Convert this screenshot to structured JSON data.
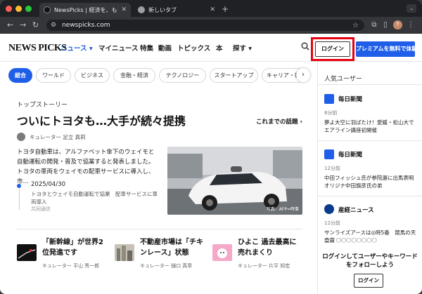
{
  "browser": {
    "tabs": [
      {
        "title": "NewsPicks | 経済を、もっとおも",
        "active": true
      },
      {
        "title": "新しいタブ",
        "active": false
      }
    ],
    "new_tab": "+",
    "url": "newspicks.com",
    "profile_initial": "T"
  },
  "header": {
    "logo": "NEWS PICKS",
    "nav": [
      "ニュース ▾",
      "マイニュース",
      "特集",
      "動画",
      "トピックス",
      "本",
      "探す ▾"
    ],
    "login": "ログイン",
    "premium": "プレミアムを無料で体験"
  },
  "chips": [
    "総合",
    "ワールド",
    "ビジネス",
    "金融・経済",
    "テクノロジー",
    "スタートアップ",
    "キャリア・教"
  ],
  "top_story": {
    "section": "トップストーリー",
    "headline": "ついにトヨタも…大手が続々提携",
    "more": "これまでの話題 ›",
    "curator": "キュレーター 足立 真莉",
    "body": "トヨタ自動車は、アルファベット傘下のウェイモと自動運転の開発・普及で協業すると発表しました。トヨタの車両をウェイモの配車サービスに導入し、市…",
    "timeline_date": "2025/04/30",
    "timeline_text": "トヨタとウェイモ自動運転で協業　配車サービスに車両導入",
    "timeline_source": "共同通信",
    "photo_credit": "写真：AFP=時事"
  },
  "cards": [
    {
      "title": "「新幹線」が世界2位発進です",
      "curator": "キュレーター 平山 秀一郎"
    },
    {
      "title": "不動産市場は「チキンレース」状態",
      "curator": "キュレーター 樋口 真章"
    },
    {
      "title": "ひよこ 過去最高に売れまくり",
      "curator": "キュレーター 片平 知宏"
    }
  ],
  "sidebar": {
    "title": "人気ユーザー",
    "items": [
      {
        "name": "毎日新聞",
        "time": "8分前",
        "text": "夢よ大空に羽ばたけ！愛媛・松山大でエアライン講座初開催",
        "icon_color": "#1f5ee8"
      },
      {
        "name": "毎日新聞",
        "time": "12分前",
        "text": "中田フィッシュ氏が参院選に出馬表明 オリジナ中田旗彦氏の弟",
        "icon_color": "#1f5ee8"
      },
      {
        "name": "産経ニュース",
        "time": "12分前",
        "text": "サンライズアースは◎時5番　競馬の天皇賞",
        "more": "◯◯ ◯◯◯◯◯◯◯◯",
        "icon_color": "#0a3c8c"
      }
    ],
    "follow_cta": "ログインしてユーザーやキーワードをフォローしよう",
    "login": "ログイン"
  },
  "colors": {
    "accent": "#1f5ee8",
    "highlight_box": "#e8000f"
  }
}
